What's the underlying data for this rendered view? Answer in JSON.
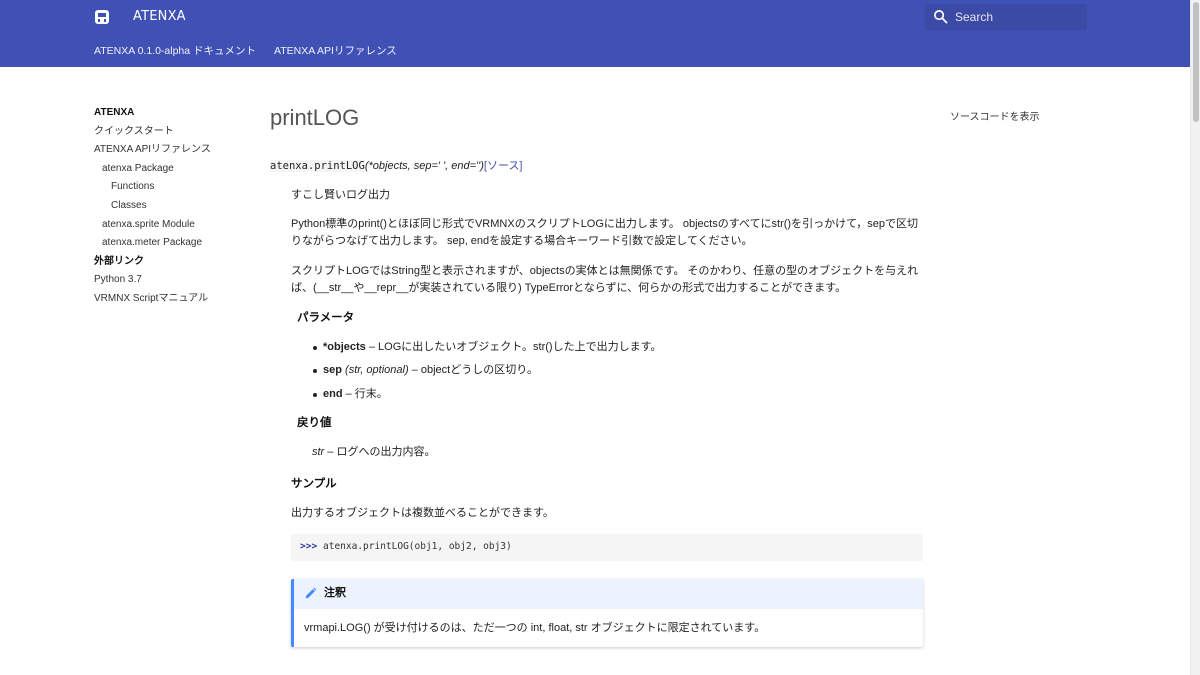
{
  "header": {
    "site_title": "ATENXA",
    "search_placeholder": "Search",
    "tabs": [
      {
        "label": "ATENXA 0.1.0-alpha ドキュメント"
      },
      {
        "label": "ATENXA APIリファレンス"
      }
    ]
  },
  "sidebar": {
    "items": [
      {
        "label": "ATENXA"
      },
      {
        "label": "クイックスタート"
      },
      {
        "label": "ATENXA APIリファレンス"
      },
      {
        "label": "atenxa Package"
      },
      {
        "label": "Functions"
      },
      {
        "label": "Classes"
      },
      {
        "label": "atenxa.sprite Module"
      },
      {
        "label": "atenxa.meter Package"
      },
      {
        "label": "外部リンク"
      },
      {
        "label": "Python 3.7"
      },
      {
        "label": "VRMNX Scriptマニュアル"
      }
    ]
  },
  "toc": {
    "source_label": "ソースコードを表示"
  },
  "main": {
    "title": "printLOG",
    "signature": {
      "name": "atenxa.printLOG",
      "params": "(*objects, sep=' ', end='')",
      "source_link": "[ソース]"
    },
    "summary": "すこし賢いログ出力",
    "paragraph1": "Python標準のprint()とほぼ同じ形式でVRMNXのスクリプトLOGに出力します。 objectsのすべてにstr()を引っかけて，sepで区切りながらつなげて出力します。 sep, endを設定する場合キーワード引数で設定してください。",
    "paragraph2": "スクリプトLOGではString型と表示されますが、objectsの実体とは無関係です。 そのかわり、任意の型のオブジェクトを与えれば、(__str__や__repr__が実装されている限り) TypeErrorとならずに、何らかの形式で出力することができます。",
    "params_heading": "パラメータ",
    "params": [
      {
        "name": "*objects",
        "type": "",
        "desc": " – LOGに出したいオブジェクト。str()した上で出力します。"
      },
      {
        "name": "sep",
        "type": " (str, optional)",
        "desc": " – objectどうしの区切り。"
      },
      {
        "name": "end",
        "type": "",
        "desc": " – 行末。"
      }
    ],
    "returns_heading": "戻り値",
    "returns_type": "str",
    "returns_desc": " – ログへの出力内容。",
    "sample_heading": "サンプル",
    "sample_text": "出力するオブジェクトは複数並べることができます。",
    "code_prompt": ">>>",
    "code_text": "atenxa.printLOG(obj1, obj2, obj3)",
    "note_title": "注釈",
    "note_body": "vrmapi.LOG() が受け付けるのは、ただ一つの int, float, str オブジェクトに限定されています。"
  }
}
